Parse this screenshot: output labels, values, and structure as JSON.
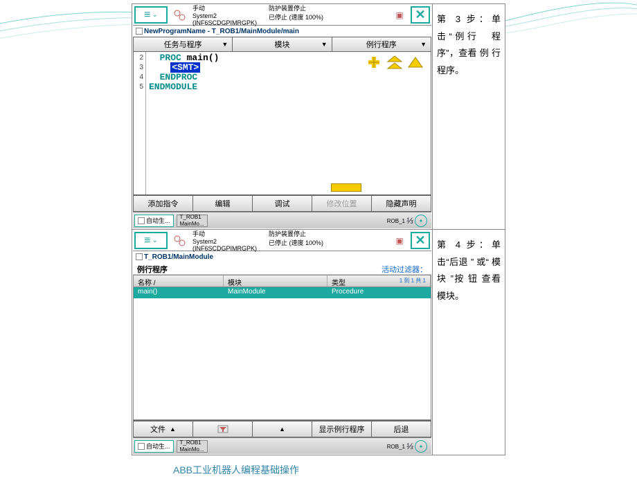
{
  "panel1": {
    "status": {
      "left1": "手动",
      "right1": "防护装置停止",
      "left2": "System2 (INF6SCDGPIMRGPK)",
      "right2": "已停止 (速度 100%)"
    },
    "path": "NewProgramName - T_ROB1/MainModule/main",
    "tabs": [
      "任务与程序",
      "模块",
      "例行程序"
    ],
    "gutter": [
      "2",
      "3",
      "4",
      "5"
    ],
    "code": {
      "l1a": "  PROC ",
      "l1b": "main()",
      "l2a": "    ",
      "l2b": "<SMT>",
      "l3": "  ENDPROC",
      "l4": "ENDMODULE"
    },
    "bottom": [
      "添加指令",
      "编辑",
      "调试",
      "修改位置",
      "隐藏声明"
    ],
    "tasks": {
      "a": "自动生...",
      "b1": "T_ROB1",
      "b2": "MainMo..."
    },
    "rob": {
      "label": "ROB_1",
      "frac": "⅓"
    }
  },
  "panel2": {
    "status": {
      "left1": "手动",
      "right1": "防护装置停止",
      "left2": "System2 (INF6SCDGPIMRGPK)",
      "right2": "已停止 (速度 100%)"
    },
    "path": "T_ROB1/MainModule",
    "modlabel": "例行程序",
    "filter": "活动过滤器：",
    "headers": {
      "c1": "名称 /",
      "c2": "模块",
      "c3": "类型",
      "range": "1 到 1 共 1"
    },
    "row": {
      "c1": "main()",
      "c2": "MainModule",
      "c3": "Procedure"
    },
    "bottom": [
      "文件",
      "",
      "",
      "显示例行程序",
      "后退"
    ],
    "tasks": {
      "a": "自动生...",
      "b1": "T_ROB1",
      "b2": "MainMo..."
    },
    "rob": {
      "label": "ROB_1",
      "frac": "⅓"
    }
  },
  "desc": {
    "step3": "第 3 步：单击“例行　程序”，查看 例 行程序。",
    "step4": "第 4 步：单击“后退 ” 或“ 模 块 ”按 钮 查看模块。"
  },
  "footer": "ABB工业机器人编程基础操作"
}
